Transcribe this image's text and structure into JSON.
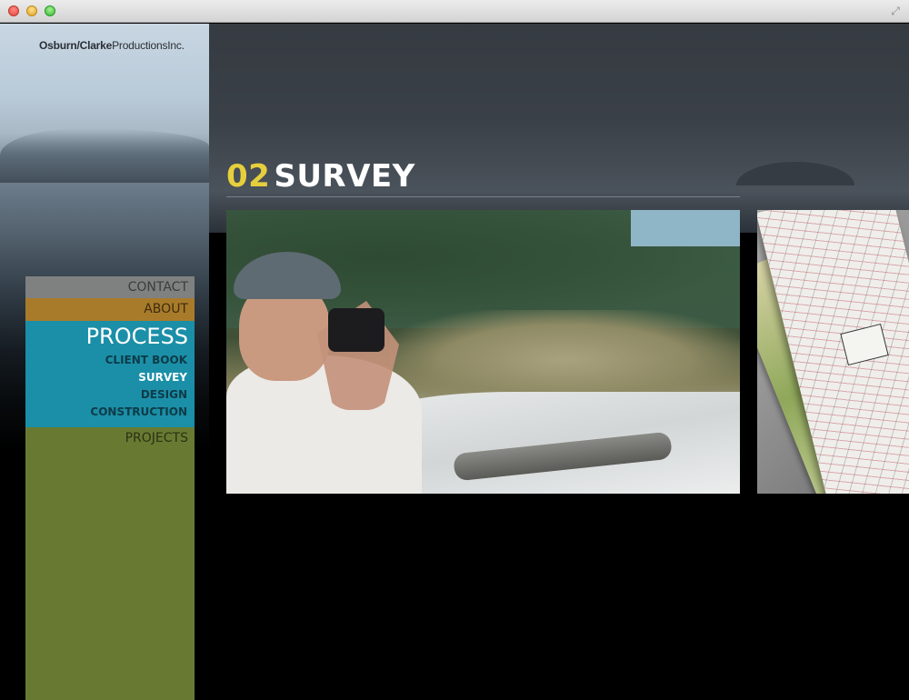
{
  "brand": {
    "name_bold": "Osburn/Clarke",
    "name_rest": "ProductionsInc."
  },
  "heading": {
    "number": "02",
    "title": "SURVEY"
  },
  "nav": {
    "contact": "CONTACT",
    "about": "ABOUT",
    "process": "PROCESS",
    "process_items": [
      "CLIENT BOOK",
      "SURVEY",
      "DESIGN",
      "CONSTRUCTION"
    ],
    "active_process_item": "SURVEY",
    "projects": "PROJECTS"
  },
  "colors": {
    "contact": "#7f8080",
    "about": "#a87b2b",
    "process": "#1b8fa8",
    "projects": "#687a32",
    "heading_number": "#e6cf3c"
  },
  "images": {
    "main": "man-photographing-coastal-rocks",
    "next": "site-survey-plans"
  }
}
